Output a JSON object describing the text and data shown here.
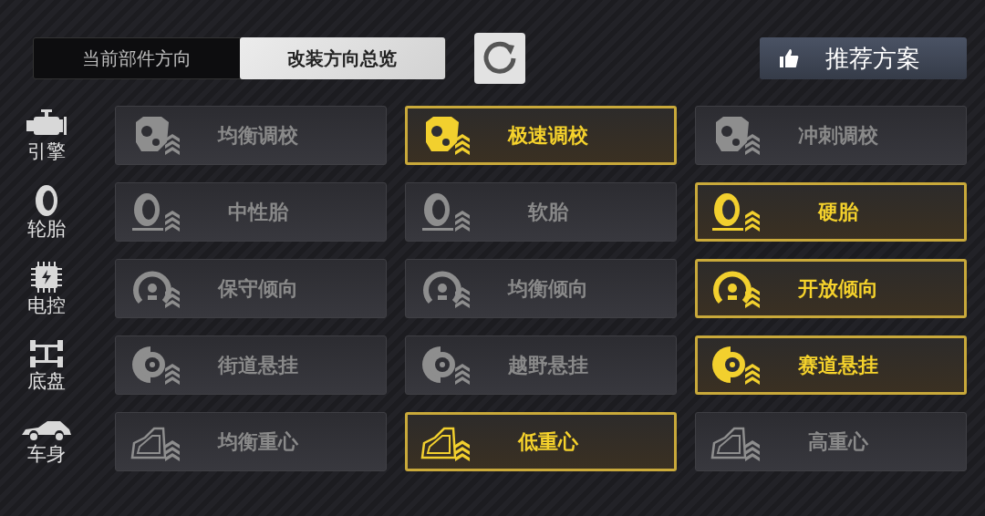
{
  "tabs": [
    {
      "label": "当前部件方向",
      "selected": false
    },
    {
      "label": "改装方向总览",
      "selected": true
    }
  ],
  "recommend_button": {
    "label": "推荐方案"
  },
  "rows": [
    {
      "kind": "engine",
      "category": "引擎",
      "options": [
        {
          "label": "均衡调校",
          "selected": false
        },
        {
          "label": "极速调校",
          "selected": true
        },
        {
          "label": "冲刺调校",
          "selected": false
        }
      ]
    },
    {
      "kind": "tire",
      "category": "轮胎",
      "options": [
        {
          "label": "中性胎",
          "selected": false
        },
        {
          "label": "软胎",
          "selected": false
        },
        {
          "label": "硬胎",
          "selected": true
        }
      ]
    },
    {
      "kind": "ecu",
      "category": "电控",
      "options": [
        {
          "label": "保守倾向",
          "selected": false
        },
        {
          "label": "均衡倾向",
          "selected": false
        },
        {
          "label": "开放倾向",
          "selected": true
        }
      ]
    },
    {
      "kind": "chassis",
      "category": "底盘",
      "options": [
        {
          "label": "街道悬挂",
          "selected": false
        },
        {
          "label": "越野悬挂",
          "selected": false
        },
        {
          "label": "赛道悬挂",
          "selected": true
        }
      ]
    },
    {
      "kind": "body",
      "category": "车身",
      "options": [
        {
          "label": "均衡重心",
          "selected": false
        },
        {
          "label": "低重心",
          "selected": true
        },
        {
          "label": "高重心",
          "selected": false
        }
      ]
    }
  ]
}
